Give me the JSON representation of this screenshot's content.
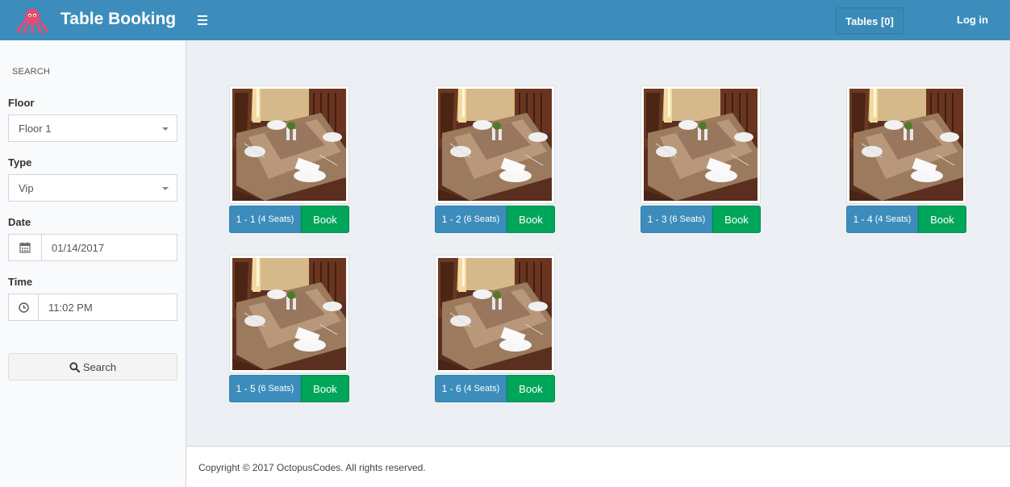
{
  "header": {
    "brand_title": "Table Booking",
    "tables_button": "Tables [0]",
    "login_label": "Log in",
    "color": "#3c8dbc"
  },
  "sidebar": {
    "heading": "SEARCH",
    "floor_label": "Floor",
    "floor_value": "Floor 1",
    "type_label": "Type",
    "type_value": "Vip",
    "date_label": "Date",
    "date_value": "01/14/2017",
    "time_label": "Time",
    "time_value": "11:02 PM",
    "search_button": "Search"
  },
  "tables": [
    {
      "name": "1 - 1",
      "seats": "(4 Seats)",
      "book": "Book"
    },
    {
      "name": "1 - 2",
      "seats": "(6 Seats)",
      "book": "Book"
    },
    {
      "name": "1 - 3",
      "seats": "(6 Seats)",
      "book": "Book"
    },
    {
      "name": "1 - 4",
      "seats": "(4 Seats)",
      "book": "Book"
    },
    {
      "name": "1 - 5",
      "seats": "(6 Seats)",
      "book": "Book"
    },
    {
      "name": "1 - 6",
      "seats": "(4 Seats)",
      "book": "Book"
    }
  ],
  "footer": {
    "copyright": "Copyright © 2017 OctopusCodes. All rights reserved."
  },
  "colors": {
    "primary": "#3c8dbc",
    "success": "#00a65a",
    "background": "#ecf0f5"
  }
}
